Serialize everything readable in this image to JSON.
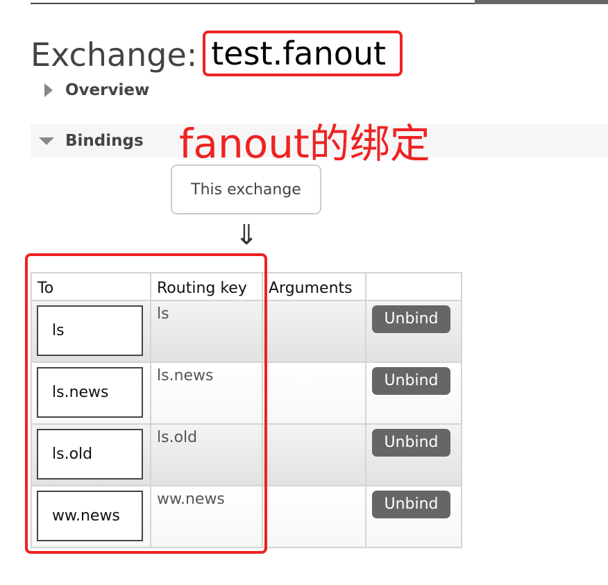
{
  "page": {
    "title_label": "Exchange:",
    "exchange_name": "test.fanout"
  },
  "sections": {
    "overview_label": "Overview",
    "bindings_label": "Bindings"
  },
  "annotation": {
    "text": "fanout的绑定",
    "color": "#ee2222"
  },
  "bindings": {
    "this_exchange_label": "This exchange",
    "arrow": "⇓",
    "columns": {
      "to": "To",
      "routing_key": "Routing key",
      "arguments": "Arguments",
      "action": ""
    },
    "rows": [
      {
        "to": "ls",
        "routing_key": "ls",
        "arguments": "",
        "action": "Unbind"
      },
      {
        "to": "ls.news",
        "routing_key": "ls.news",
        "arguments": "",
        "action": "Unbind"
      },
      {
        "to": "ls.old",
        "routing_key": "ls.old",
        "arguments": "",
        "action": "Unbind"
      },
      {
        "to": "ww.news",
        "routing_key": "ww.news",
        "arguments": "",
        "action": "Unbind"
      }
    ]
  },
  "colors": {
    "highlight": "#ee2222",
    "button_bg": "#666666",
    "title_text": "#444444"
  }
}
